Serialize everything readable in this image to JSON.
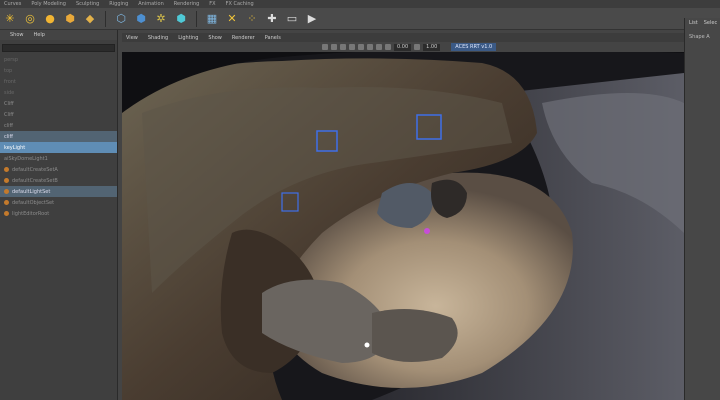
{
  "shelf_tabs": [
    "Curves",
    "Poly Modeling",
    "Sculpting",
    "Rigging",
    "Animation",
    "Rendering",
    "FX",
    "FX Caching"
  ],
  "shelf_icons": [
    "sun-icon",
    "torus-icon",
    "sphere-icon",
    "hex-icon",
    "cube-icon",
    "cube-wire-icon",
    "cube-solid-icon",
    "spiral-icon",
    "cube-teal-icon",
    "grid-icon",
    "grid-x-icon",
    "dots-icon",
    "cross-icon",
    "display-icon",
    "play-icon"
  ],
  "outliner": {
    "menu": [
      "Show",
      "Help"
    ],
    "items": [
      {
        "label": "persp",
        "state": "dim"
      },
      {
        "label": "top",
        "state": "dim"
      },
      {
        "label": "front",
        "state": "dim"
      },
      {
        "label": "side",
        "state": "dim"
      },
      {
        "label": "Cliff",
        "state": "normal"
      },
      {
        "label": "Cliff",
        "state": "normal"
      },
      {
        "label": "cliff",
        "state": "normal"
      },
      {
        "label": "cliff",
        "state": "hl"
      },
      {
        "label": "keyLight",
        "state": "sel"
      },
      {
        "label": "aiSkyDomeLight1",
        "state": "normal"
      },
      {
        "label": "defaultCreateSetA",
        "state": "normal",
        "bullet": true
      },
      {
        "label": "defaultCreateSetB",
        "state": "normal",
        "bullet": true
      },
      {
        "label": "defaultLightSet",
        "state": "hl",
        "bullet": true
      },
      {
        "label": "defaultObjectSet",
        "state": "normal",
        "bullet": true
      },
      {
        "label": "lightEditorRoot",
        "state": "normal",
        "bullet": true
      }
    ]
  },
  "viewport": {
    "menu": [
      "View",
      "Shading",
      "Lighting",
      "Show",
      "Renderer",
      "Panels"
    ],
    "values": [
      "0.00",
      "1.00"
    ],
    "colorspace": "ACES RRT v1.0"
  },
  "right_panel": {
    "tabs": [
      "List",
      "Selec"
    ],
    "field": "Shape A"
  }
}
